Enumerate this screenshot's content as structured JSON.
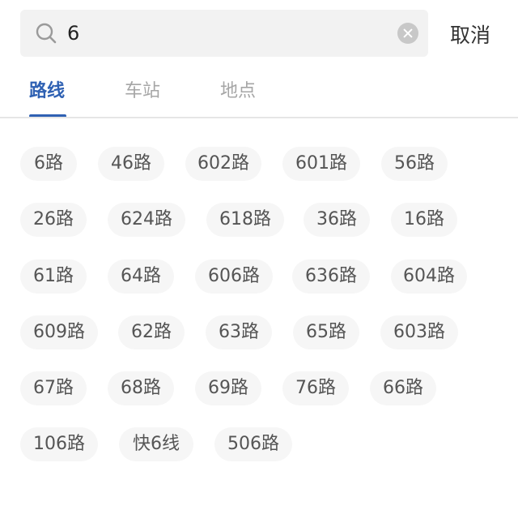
{
  "search": {
    "value": "6",
    "placeholder": ""
  },
  "cancel_label": "取消",
  "tabs": [
    {
      "label": "路线",
      "active": true
    },
    {
      "label": "车站",
      "active": false
    },
    {
      "label": "地点",
      "active": false
    }
  ],
  "colors": {
    "accent": "#2f61b3",
    "chip_bg": "#f6f6f6",
    "search_bg": "#f2f2f2"
  },
  "routes": [
    "6路",
    "46路",
    "602路",
    "601路",
    "56路",
    "26路",
    "624路",
    "618路",
    "36路",
    "16路",
    "61路",
    "64路",
    "606路",
    "636路",
    "604路",
    "609路",
    "62路",
    "63路",
    "65路",
    "603路",
    "67路",
    "68路",
    "69路",
    "76路",
    "66路",
    "106路",
    "快6线",
    "506路"
  ]
}
